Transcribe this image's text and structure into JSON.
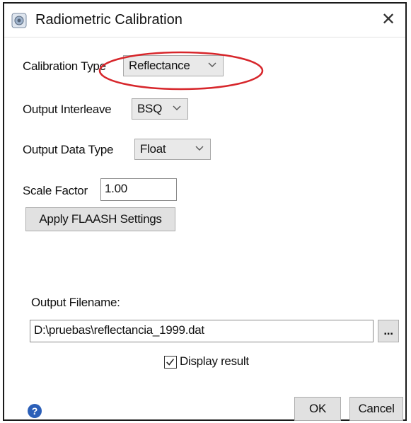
{
  "window": {
    "title": "Radiometric Calibration",
    "close_label": "✕"
  },
  "form": {
    "calibration_type_label": "Calibration Type",
    "calibration_type_value": "Reflectance",
    "output_interleave_label": "Output Interleave",
    "output_interleave_value": "BSQ",
    "output_data_type_label": "Output Data Type",
    "output_data_type_value": "Float",
    "scale_factor_label": "Scale Factor",
    "scale_factor_value": "1.00",
    "apply_flaash_label": "Apply FLAASH Settings",
    "output_filename_label": "Output Filename:",
    "output_filename_value": "D:\\pruebas\\reflectancia_1999.dat",
    "browse_label": "...",
    "display_result_label": "Display result",
    "display_result_checked": true
  },
  "footer": {
    "help_icon": "question-icon",
    "help_label": "?",
    "ok_label": "OK",
    "cancel_label": "Cancel"
  },
  "colors": {
    "annotation_ellipse": "#d7262b",
    "help_icon": "#2b5fb8"
  }
}
